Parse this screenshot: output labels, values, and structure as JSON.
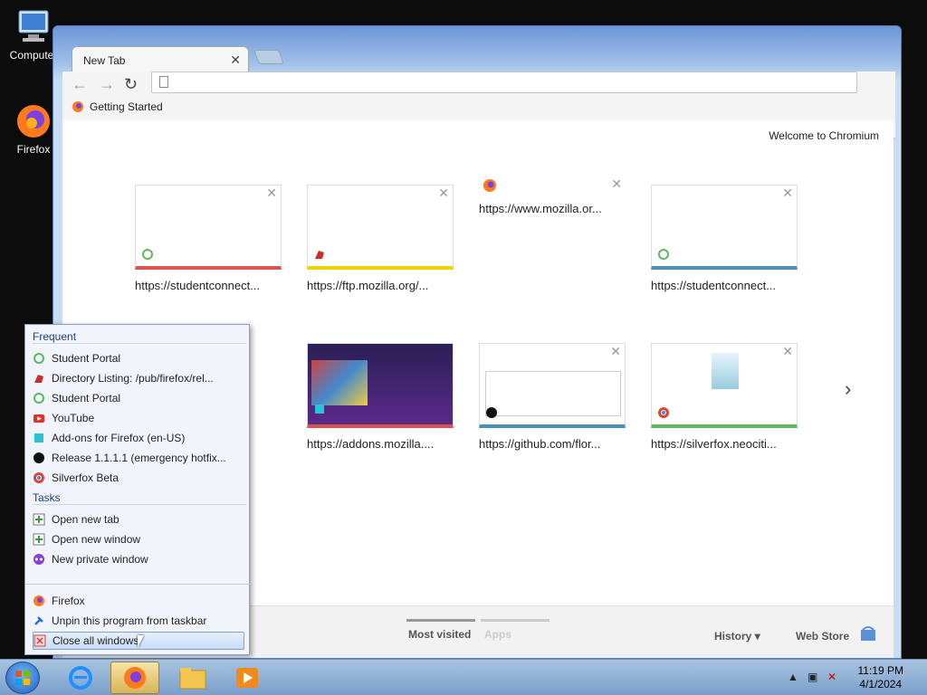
{
  "desktop": {
    "icons": [
      {
        "label": "Computer",
        "icon": "computer-icon"
      },
      {
        "label": "Firefox",
        "icon": "firefox-icon"
      }
    ]
  },
  "browser": {
    "tab_title": "New Tab",
    "address_value": "",
    "bookmark": "Getting Started",
    "welcome": "Welcome to Chromium",
    "tiles": [
      {
        "caption": "https://studentconnect...",
        "bar": "#d9534f",
        "fav": "q-icon"
      },
      {
        "caption": "https://ftp.mozilla.org/...",
        "bar": "#f0d400",
        "fav": "dino-icon"
      },
      {
        "caption": "https://www.mozilla.or...",
        "bar": "",
        "fav": "firefox-icon"
      },
      {
        "caption": "https://studentconnect...",
        "bar": "#4a90b8",
        "fav": "q-icon"
      },
      {
        "caption": "https://addons.mozilla....",
        "bar": "#d9534f",
        "fav": "addon-icon"
      },
      {
        "caption": "https://github.com/flor...",
        "bar": "#4a90b8",
        "fav": "github-icon"
      },
      {
        "caption": "https://silverfox.neociti...",
        "bar": "#5cb85c",
        "fav": "chrome-icon"
      }
    ],
    "bottom": {
      "most_visited": "Most visited",
      "apps": "Apps",
      "history": "History",
      "web_store": "Web Store"
    }
  },
  "jumplist": {
    "frequent_header": "Frequent",
    "frequent": [
      {
        "label": "Student Portal",
        "icon": "q-icon"
      },
      {
        "label": "Directory Listing: /pub/firefox/rel...",
        "icon": "dino-icon"
      },
      {
        "label": "Student Portal",
        "icon": "q-icon"
      },
      {
        "label": "YouTube",
        "icon": "youtube-icon"
      },
      {
        "label": "Add-ons for Firefox (en-US)",
        "icon": "addon-icon"
      },
      {
        "label": "Release 1.1.1.1 (emergency hotfix...",
        "icon": "github-icon"
      },
      {
        "label": "Silverfox Beta",
        "icon": "chrome-icon"
      }
    ],
    "tasks_header": "Tasks",
    "tasks": [
      {
        "label": "Open new tab",
        "icon": "plus-icon"
      },
      {
        "label": "Open new window",
        "icon": "plus-icon"
      },
      {
        "label": "New private window",
        "icon": "mask-icon"
      }
    ],
    "bottom": [
      {
        "label": "Firefox",
        "icon": "firefox-icon"
      },
      {
        "label": "Unpin this program from taskbar",
        "icon": "pin-icon"
      },
      {
        "label": "Close all windows",
        "icon": "close-icon"
      }
    ]
  },
  "taskbar": {
    "time": "11:19 PM",
    "date": "4/1/2024"
  },
  "colors": {
    "accent": "#3d6fc7",
    "hover": "#c7dcf5"
  }
}
